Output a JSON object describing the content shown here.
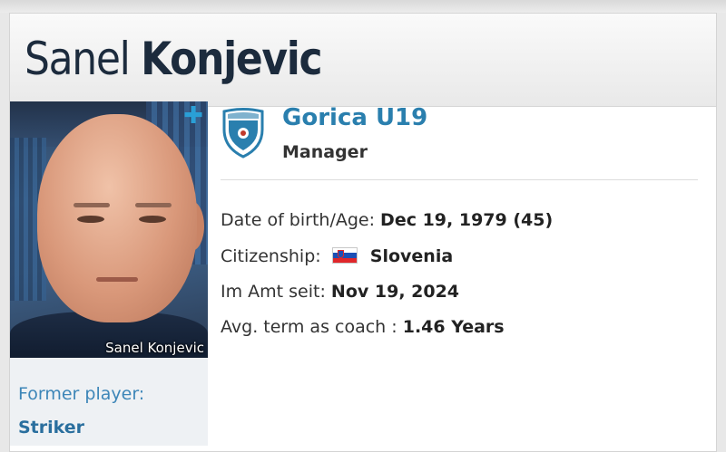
{
  "profile": {
    "first_name": "Sanel",
    "last_name": "Konjevic",
    "photo_caption": "Sanel Konjevic",
    "photo_action_icon": "plus-icon"
  },
  "club": {
    "name": "Gorica U19",
    "role": "Manager",
    "crest_icon": "club-crest-icon",
    "crest_colors": {
      "primary": "#2a7fae",
      "secondary": "#ffffff",
      "accent": "#c0392b"
    }
  },
  "details": {
    "dob": {
      "label": "Date of birth/Age:",
      "value": "Dec 19, 1979 (45)"
    },
    "citizenship": {
      "label": "Citizenship:",
      "value": "Slovenia",
      "flag_icon": "slovenia-flag-icon"
    },
    "appointed": {
      "label": "Im Amt seit:",
      "value": "Nov 19, 2024"
    },
    "avg_term": {
      "label": "Avg. term as coach :",
      "value": "1.46 Years"
    }
  },
  "former": {
    "label": "Former player:",
    "value": "Striker"
  },
  "colors": {
    "name_text": "#1c2b3d",
    "link_blue": "#2a7fae",
    "former_label": "#3d86b8"
  }
}
